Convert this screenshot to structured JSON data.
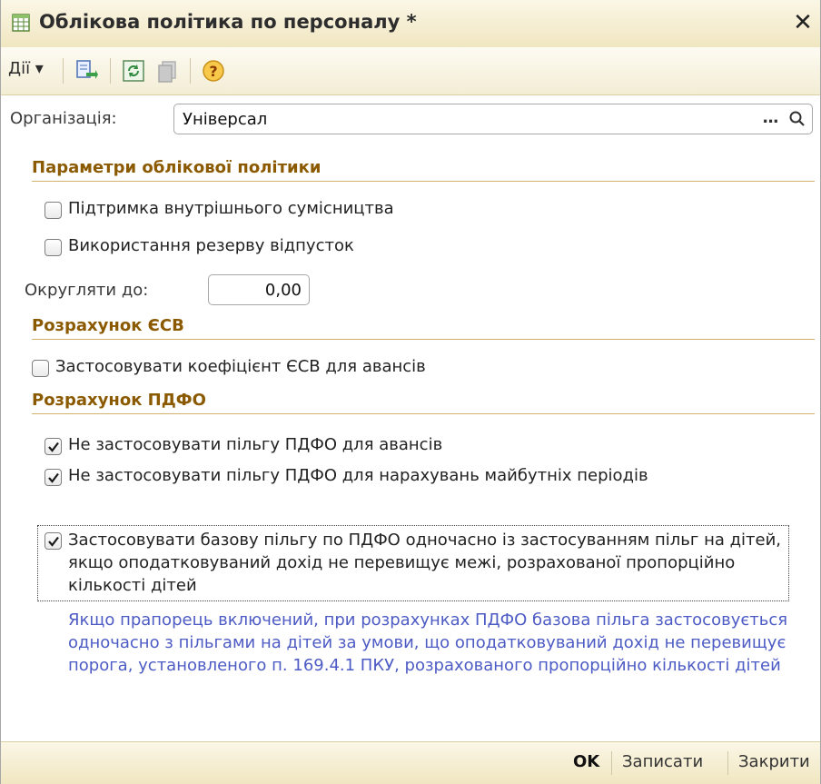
{
  "window": {
    "title": "Облікова політика по персоналу *",
    "close_label": "✕"
  },
  "toolbar": {
    "actions_label": "Дії ▾"
  },
  "form": {
    "organization": {
      "label": "Організація:",
      "value": "Універсал",
      "select_label": "...",
      "search_label": "🔍"
    },
    "sections": {
      "accounting": "Параметри облікової політики",
      "esv": "Розрахунок ЄСВ",
      "pdfo": "Розрахунок ПДФО"
    },
    "checkboxes": {
      "internal_combining": {
        "label": "Підтримка внутрішнього сумісництва",
        "checked": false
      },
      "vacation_reserve": {
        "label": "Використання резерву відпусток",
        "checked": false
      },
      "esv_advance_coef": {
        "label": "Застосовувати коефіцієнт ЄСВ для авансів",
        "checked": false
      },
      "no_pdfo_benefit_advance": {
        "label": "Не застосовувати пільгу ПДФО для авансів",
        "checked": true
      },
      "no_pdfo_benefit_future": {
        "label": "Не застосовувати пільгу ПДФО для нарахувань майбутніх періодів",
        "checked": true
      },
      "base_benefit_with_children": {
        "label": "Застосовувати базову пільгу по ПДФО одночасно із застосуванням пільг на дітей, якщо оподатковуваний дохід не перевищує межі, розрахованої пропорційно кількості дітей",
        "checked": true
      }
    },
    "rounding": {
      "label": "Округляти до:",
      "value": "0,00"
    },
    "hint": "Якщо прапорець включений, при розрахунках ПДФО базова пільга застосовується одночасно з пільгами на дітей за умови, що оподатковуваний дохід не перевищує порога, установленого п. 169.4.1 ПКУ, розрахованого пропорційно кількості дітей"
  },
  "footer": {
    "ok_label": "OK",
    "save_label": "Записати",
    "close_label": "Закрити"
  },
  "colors": {
    "section_title": "#8b5a00",
    "hint": "#4d5bc4",
    "panel_bg": "#f3edd5"
  }
}
